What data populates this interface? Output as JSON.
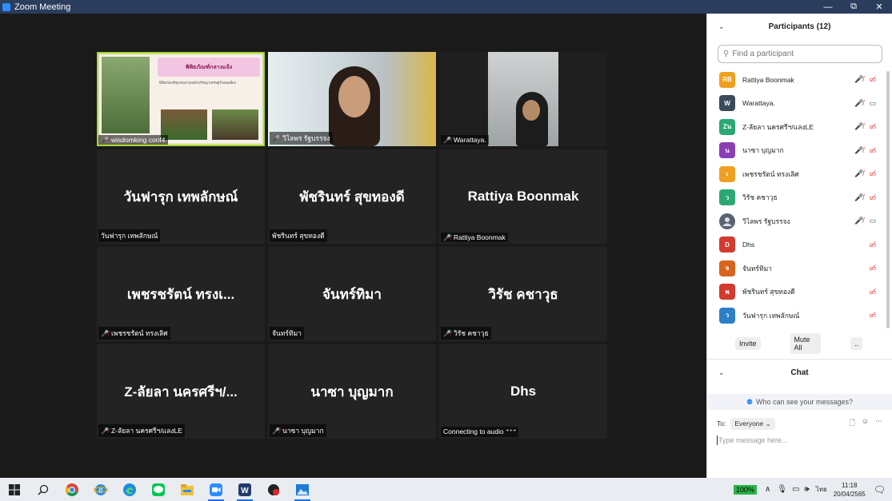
{
  "window": {
    "title": "Zoom Meeting",
    "minimize": "—",
    "restore": "⧉",
    "close": "✕"
  },
  "tiles": [
    {
      "name": "wisdomking conf4",
      "type": "slide",
      "muted": true,
      "slide_title": "พิพิธภัณฑ์กลางแจ้ง",
      "slide_text": "พิพิธภัณฑ์ชุมชนตามหลักปรัชญาเศรษฐกิจพอเพียง"
    },
    {
      "name": "วิไลพร รัฐบรรจง",
      "type": "video",
      "muted": true
    },
    {
      "name": "Warattaya.",
      "type": "video",
      "muted": true
    },
    {
      "name": "วันฟารุก เทพลักษณ์",
      "display": "วันฟารุก เทพลักษณ์",
      "muted": false
    },
    {
      "name": "พัชรินทร์ สุขทองดี",
      "display": "พัชรินทร์ สุขทองดี",
      "muted": false
    },
    {
      "name": "Rattiya Boonmak",
      "display": "Rattiya Boonmak",
      "muted": true
    },
    {
      "name": "เพชรชรัตน์  ทรงเลิศ",
      "display": "เพชรชรัตน์  ทรงเ...",
      "muted": true
    },
    {
      "name": "จันทร์ทิมา",
      "display": "จันทร์ทิมา",
      "muted": false
    },
    {
      "name": "วิรัช คชาวุธ",
      "display": "วิรัช คชาวุธ",
      "muted": true
    },
    {
      "name": "Z-ลัยลา นครศรีฯ/แลงLE",
      "display": "Z-ลัยลา นครศรีฯ/...",
      "muted": true
    },
    {
      "name": "นาซา  บุญมาก",
      "display": "นาซา  บุญมาก",
      "muted": true
    },
    {
      "name": "Connecting to audio ⁺⁺⁺",
      "display": "Dhs",
      "muted": false
    }
  ],
  "participants": {
    "title": "Participants (12)",
    "search_placeholder": "Find a participant",
    "items": [
      {
        "initials": "RB",
        "name": "Rattiya Boonmak",
        "color": "#f0a020",
        "mic_muted": true,
        "video_off": true
      },
      {
        "initials": "W",
        "name": "Warattaya.",
        "color": "#3b4a5a",
        "mic_muted": true,
        "video_off": false
      },
      {
        "initials": "Zน",
        "name": "Z-ลัยลา นครศรีฯ/แลงLE",
        "color": "#2aa874",
        "mic_muted": true,
        "video_off": true
      },
      {
        "initials": "น",
        "name": "นาซา  บุญมาก",
        "color": "#8a3fb5",
        "mic_muted": true,
        "video_off": true
      },
      {
        "initials": "เ",
        "name": "เพชรชรัตน์  ทรงเลิศ",
        "color": "#f0a020",
        "mic_muted": true,
        "video_off": true
      },
      {
        "initials": "ว",
        "name": "วิรัช คชาวุธ",
        "color": "#2aa874",
        "mic_muted": true,
        "video_off": true
      },
      {
        "initials": "",
        "name": "วิไลพร รัฐบรรจง",
        "color": "#5a6470",
        "mic_muted": true,
        "video_off": false
      },
      {
        "initials": "D",
        "name": "Dhs",
        "color": "#d23b2e",
        "mic_muted": false,
        "video_off": true
      },
      {
        "initials": "จ",
        "name": "จันทร์ทิมา",
        "color": "#d9641e",
        "mic_muted": false,
        "video_off": true
      },
      {
        "initials": "พ",
        "name": "พัชรินทร์ สุขทองดี",
        "color": "#d23b2e",
        "mic_muted": false,
        "video_off": true
      },
      {
        "initials": "ว",
        "name": "วันฟารุก เทพลักษณ์",
        "color": "#2d7fc7",
        "mic_muted": false,
        "video_off": true
      }
    ],
    "invite": "Invite",
    "mute_all": "Mute All",
    "more": ".."
  },
  "chat": {
    "title": "Chat",
    "who_can_see": "Who can see your messages?",
    "to_label": "To:",
    "to_value": "Everyone",
    "message_placeholder": "Type message here..."
  },
  "taskbar": {
    "battery": "100%",
    "lang": "ไทย",
    "time": "11:18",
    "date": "20/04/2565"
  }
}
